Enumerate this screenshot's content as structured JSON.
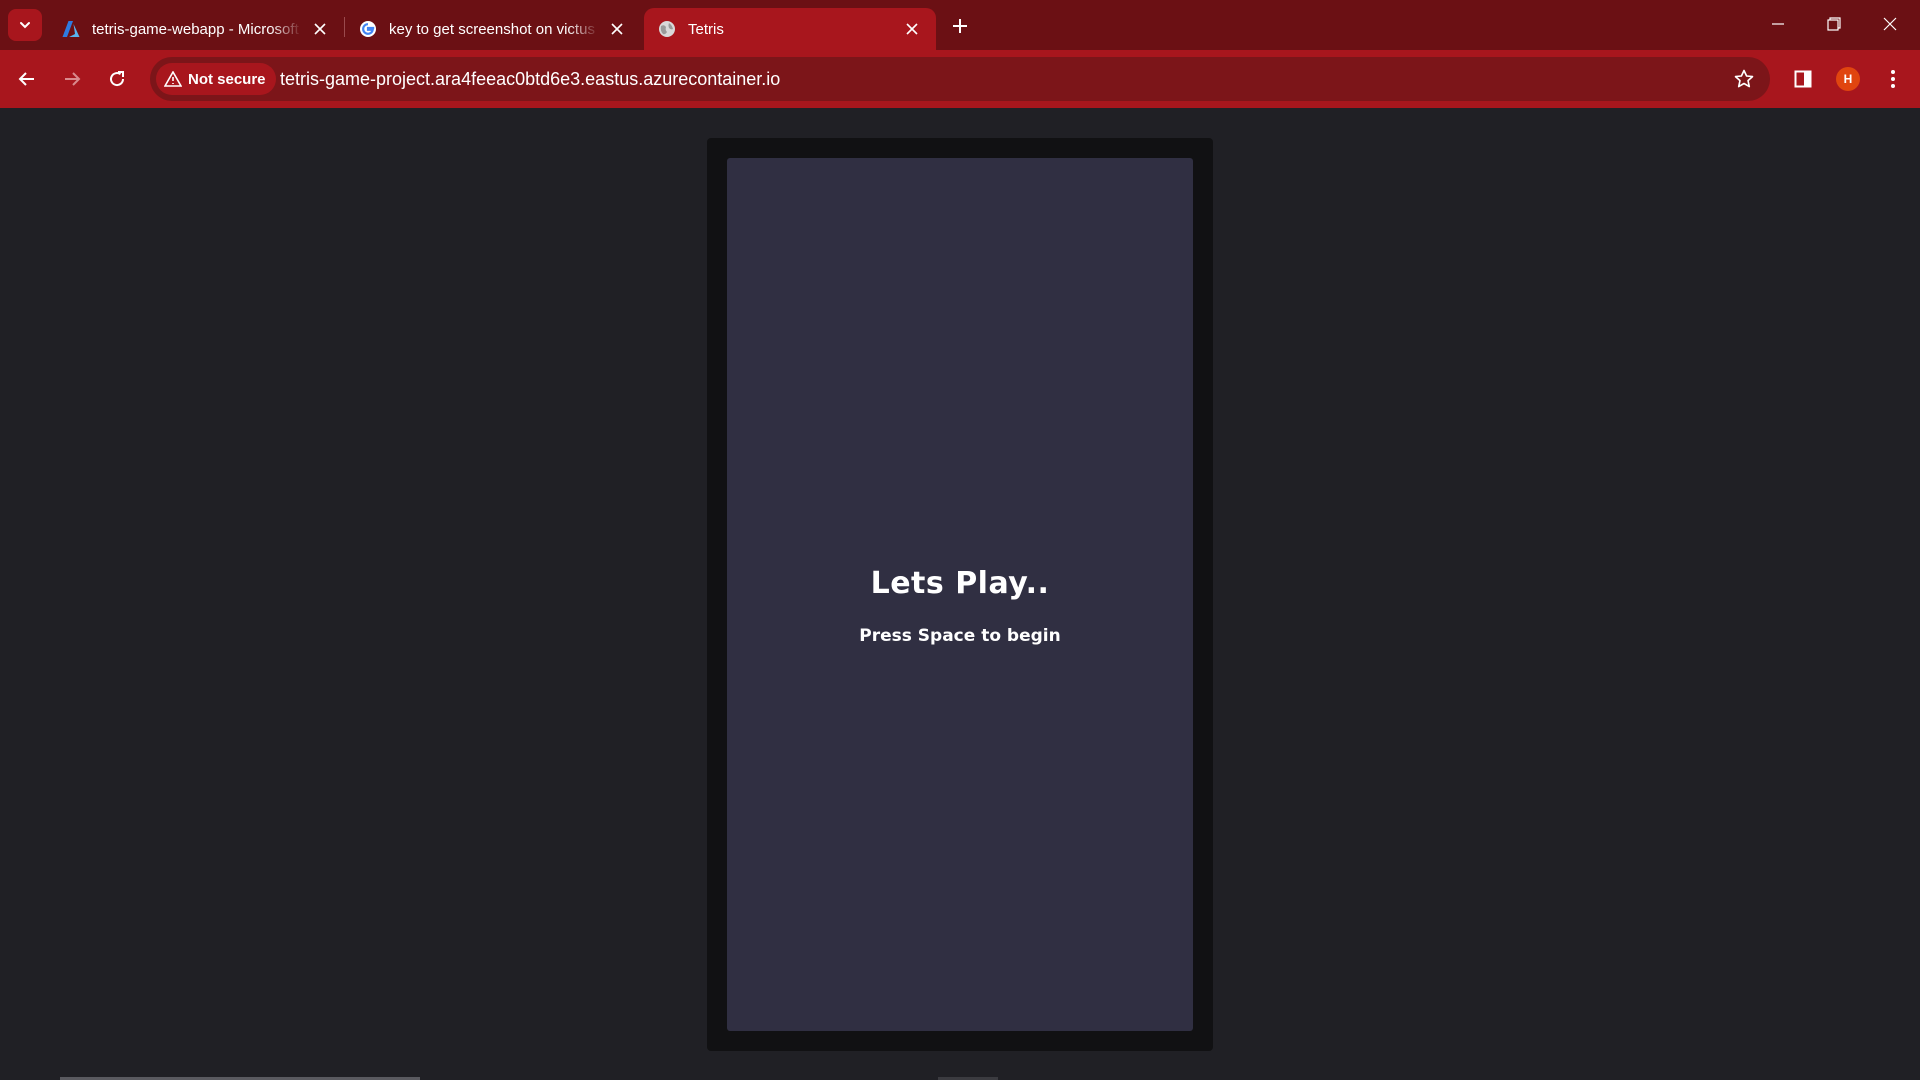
{
  "browser": {
    "tabs": [
      {
        "title": "tetris-game-webapp - Microsoft Azure",
        "favicon": "azure-icon",
        "active": false
      },
      {
        "title": "key to get screenshot on victus",
        "favicon": "google-icon",
        "active": false
      },
      {
        "title": "Tetris",
        "favicon": "globe-icon",
        "active": true
      }
    ],
    "security_label": "Not secure",
    "url": "tetris-game-project.ara4feeac0btd6e3.eastus.azurecontainer.io",
    "profile_initial": "H",
    "colors": {
      "frame": "#6b1014",
      "toolbar": "#a8161d",
      "omnibox": "#7c1519",
      "avatar": "#e0450f"
    }
  },
  "game": {
    "title": "Lets Play..",
    "subtitle": "Press Space to begin",
    "colors": {
      "background": "#202025",
      "frame": "#111113",
      "board": "#302f42"
    }
  }
}
